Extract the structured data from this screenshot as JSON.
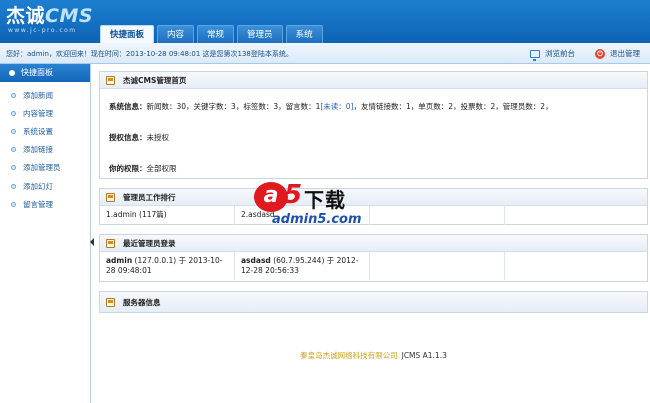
{
  "brand": {
    "logo_main": "杰诚",
    "logo_cms": "CMS",
    "logo_sub": "www.jc-pro.com"
  },
  "nav": {
    "tabs": [
      {
        "label": "快捷面板",
        "active": true
      },
      {
        "label": "内容",
        "active": false
      },
      {
        "label": "常规",
        "active": false
      },
      {
        "label": "管理员",
        "active": false
      },
      {
        "label": "系统",
        "active": false
      }
    ]
  },
  "infobar": {
    "greeting": "您好：",
    "username": "admin",
    "welcome": "，欢迎回来！现在时间：2013-10-28 09:48:01 这是您第次138登陆本系统。",
    "browse_label": "浏览前台",
    "logout_label": "退出管理"
  },
  "sidebar": {
    "header": "快捷面板",
    "items": [
      "添加新闻",
      "内容管理",
      "系统设置",
      "添加链接",
      "添加管理员",
      "添加幻灯",
      "留言管理"
    ]
  },
  "home": {
    "title": "杰诚CMS管理首页",
    "sysinfo_label": "系统信息：",
    "sysinfo_a": "新闻数：30，关键字数：3，标签数：3，留言数：1",
    "sysinfo_unread": "[未读：0]",
    "sysinfo_b": "，友情链接数：1，单页数：2，投票数：2，管理员数：2，",
    "license_label": "授权信息：",
    "license_value": "未授权",
    "perm_label": "你的权限：",
    "perm_value": "全部权限"
  },
  "ranking": {
    "title": "管理员工作排行",
    "cells": [
      "1.admin (117篇)",
      "2.asdasd"
    ]
  },
  "logins": {
    "title": "最近管理员登录",
    "entries": [
      {
        "name": "admin",
        "detail": "(127.0.0.1) 于 2013-10-28 09:48:01"
      },
      {
        "name": "asdasd",
        "detail": "(60.7.95.244) 于 2012-12-28 20:56:33"
      }
    ]
  },
  "server": {
    "title": "服务器信息"
  },
  "footer": {
    "company": "秦皇岛杰诚网络科技有限公司",
    "version": "JCMS A1.1.3"
  },
  "watermark": {
    "a": "a",
    "five": "5",
    "xiazai": "下载",
    "url": "admin5.com"
  },
  "colors": {
    "header_blue": "#0d63b6",
    "link_blue": "#1e5da0",
    "footer_gold": "#d4a11b",
    "watermark_red": "#e0191f"
  }
}
